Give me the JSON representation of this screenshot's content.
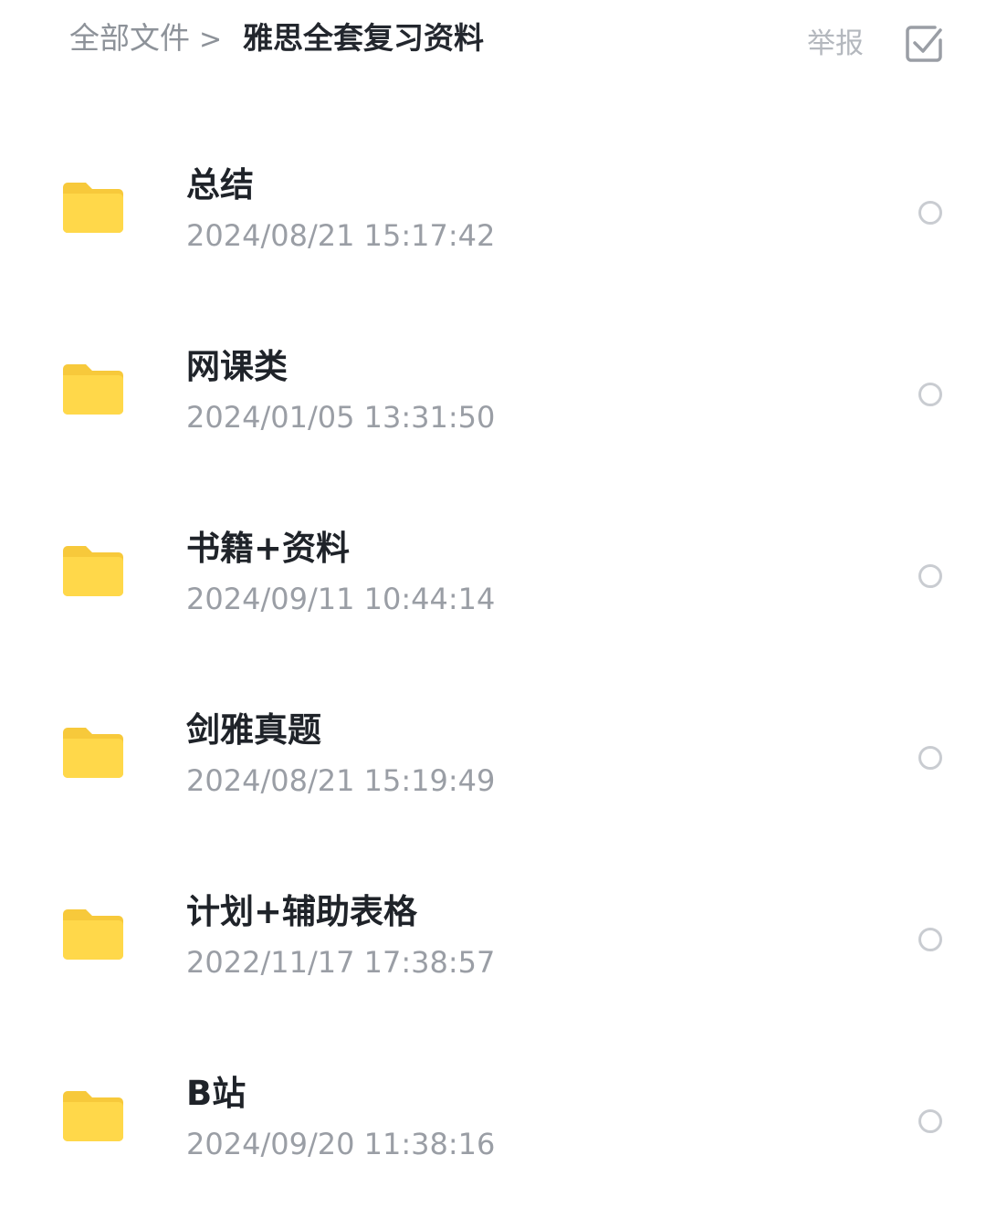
{
  "header": {
    "breadcrumb_root": "全部文件",
    "breadcrumb_separator": ">",
    "breadcrumb_current": "雅思全套复习资料",
    "report_label": "举报",
    "select_icon": "checkbox-icon"
  },
  "colors": {
    "folder": "#FFD84A",
    "folder_tab": "#F7C93B",
    "title_text": "#1F2329",
    "subtext": "#9A9EA5"
  },
  "files": [
    {
      "name": "总结",
      "time": "2024/08/21 15:17:42",
      "icon": "folder-icon"
    },
    {
      "name": "网课类",
      "time": "2024/01/05 13:31:50",
      "icon": "folder-icon"
    },
    {
      "name": "书籍+资料",
      "time": "2024/09/11 10:44:14",
      "icon": "folder-icon"
    },
    {
      "name": "剑雅真题",
      "time": "2024/08/21 15:19:49",
      "icon": "folder-icon"
    },
    {
      "name": "计划+辅助表格",
      "time": "2022/11/17 17:38:57",
      "icon": "folder-icon"
    },
    {
      "name": "B站",
      "time": "2024/09/20 11:38:16",
      "icon": "folder-icon"
    }
  ]
}
